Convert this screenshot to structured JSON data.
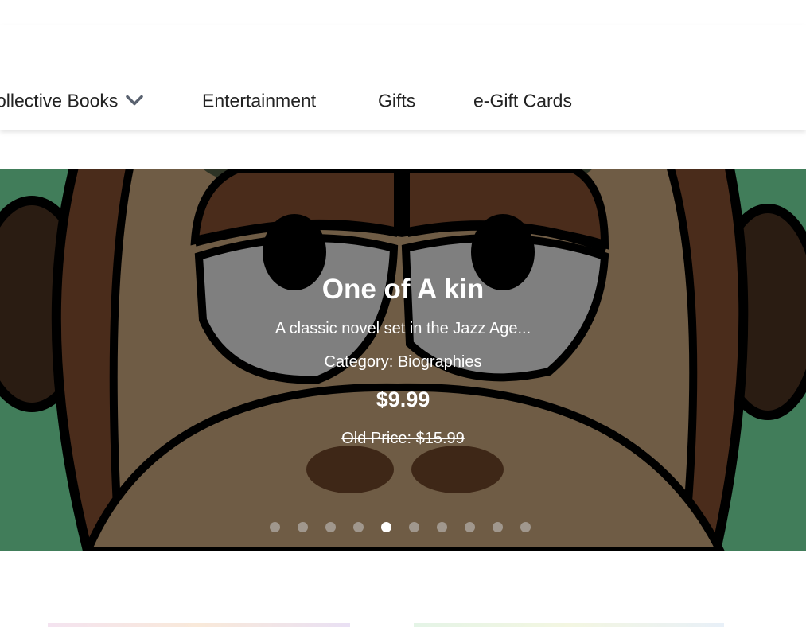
{
  "nav": {
    "items": [
      {
        "label": "ollective Books",
        "has_dropdown": true
      },
      {
        "label": "Entertainment"
      },
      {
        "label": "Gifts"
      },
      {
        "label": "e-Gift Cards"
      }
    ]
  },
  "hero": {
    "title": "One of A kin",
    "description": "A classic novel set in the Jazz Age...",
    "category": "Category: Biographies",
    "price": "$9.99",
    "old_price": "Old Price: $15.99",
    "slide_count": 10,
    "active_slide": 5
  },
  "colors": {
    "hero_background": "#417d5a",
    "nav_text": "#222222",
    "chevron": "#5a6270"
  }
}
